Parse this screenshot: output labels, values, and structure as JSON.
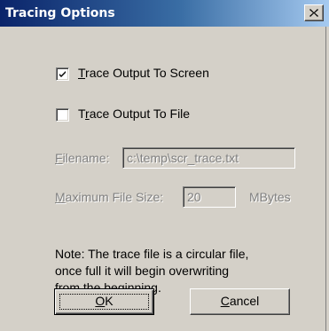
{
  "dialog": {
    "title": "Tracing Options",
    "close_label": "×"
  },
  "options": {
    "trace_screen": {
      "mnemonic": "T",
      "rest": "race Output To Screen",
      "checked": true
    },
    "trace_file": {
      "before": "T",
      "mnemonic": "r",
      "rest": "ace Output To File",
      "checked": false
    }
  },
  "filename": {
    "mnemonic": "F",
    "rest": "ilename:",
    "value": "c:\\temp\\scr_trace.txt"
  },
  "max_size": {
    "mnemonic": "M",
    "rest": "aximum File Size:",
    "value": "20",
    "unit": "MBytes"
  },
  "note": {
    "line1": "Note: The trace file is a circular file,",
    "line2": "once full it will begin overwriting",
    "line3": "from the beginning."
  },
  "buttons": {
    "ok": {
      "mnemonic": "O",
      "rest": "K"
    },
    "cancel": {
      "mnemonic": "C",
      "rest": "ancel"
    }
  }
}
